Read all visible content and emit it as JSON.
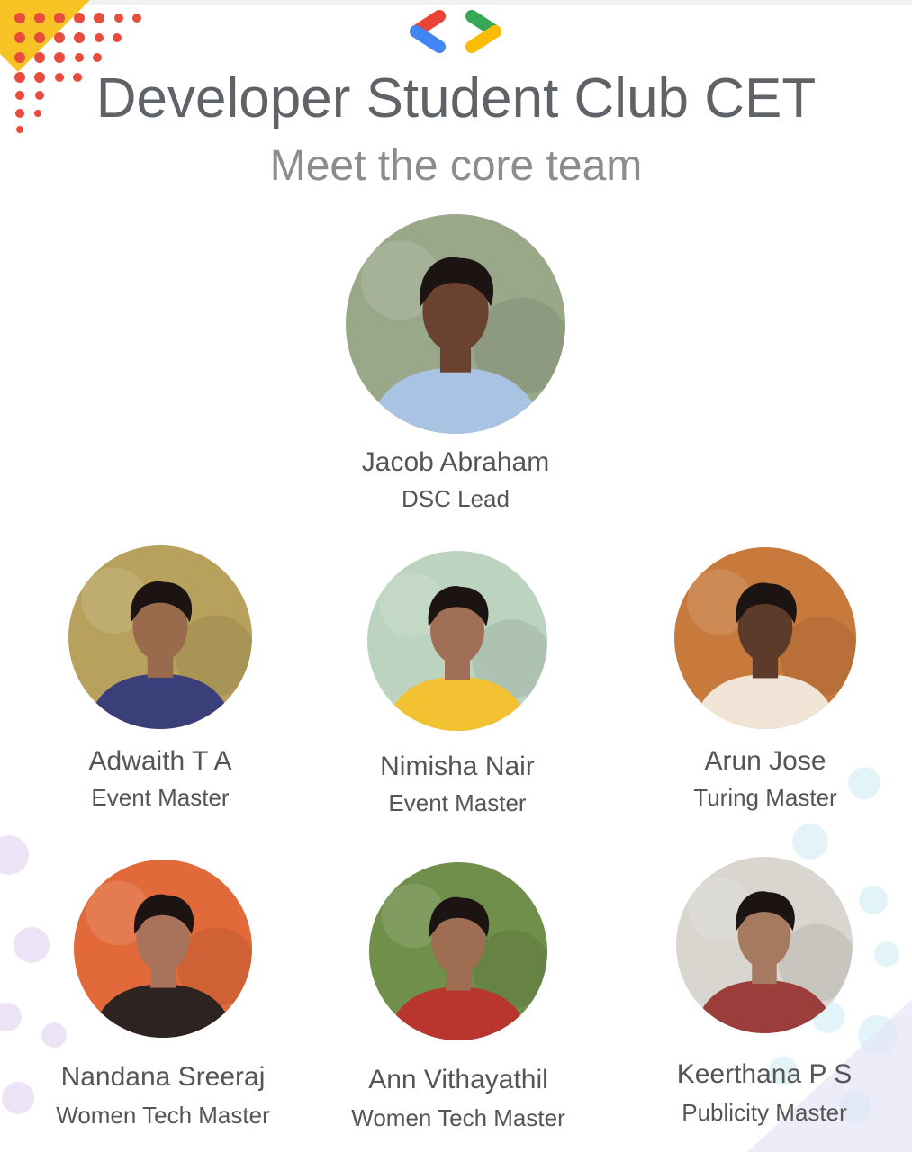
{
  "header": {
    "title": "Developer Student Club CET",
    "subtitle": "Meet the core team",
    "logo_icon": "dsc-brackets-logo",
    "logo_colors": [
      "#ea4335",
      "#4285f4",
      "#34a853",
      "#fbbc04"
    ]
  },
  "members": [
    {
      "name": "Jacob Abraham",
      "role": "DSC Lead",
      "avatar_icon": "person-photo",
      "bg": "#9aa88a",
      "shirt": "#a9c4e3",
      "skin": "#6b4230"
    },
    {
      "name": "Adwaith T A",
      "role": "Event Master",
      "avatar_icon": "person-photo",
      "bg": "#b7a15c",
      "shirt": "#3a3f7a",
      "skin": "#9a6a4c"
    },
    {
      "name": "Nimisha Nair",
      "role": "Event Master",
      "avatar_icon": "person-photo",
      "bg": "#bcd3bf",
      "shirt": "#f2c233",
      "skin": "#a06f55"
    },
    {
      "name": "Arun Jose",
      "role": "Turing Master",
      "avatar_icon": "person-photo",
      "bg": "#c87a3d",
      "shirt": "#f0e4d6",
      "skin": "#5c3b2a"
    },
    {
      "name": "Nandana Sreeraj",
      "role": "Women Tech Master",
      "avatar_icon": "person-photo",
      "bg": "#e26a3a",
      "shirt": "#2d2320",
      "skin": "#a8735a"
    },
    {
      "name": "Ann Vithayathil",
      "role": "Women Tech Master",
      "avatar_icon": "person-photo",
      "bg": "#6f8f4a",
      "shirt": "#b8362e",
      "skin": "#9e6d52"
    },
    {
      "name": "Keerthana P S",
      "role": "Publicity Master",
      "avatar_icon": "person-photo",
      "bg": "#d9d6d0",
      "shirt": "#9b3d3a",
      "skin": "#a67a60"
    }
  ]
}
